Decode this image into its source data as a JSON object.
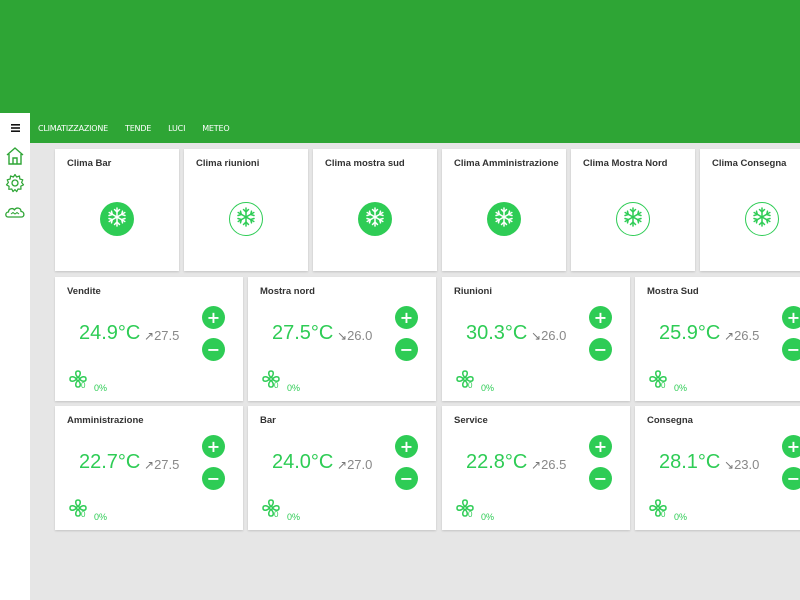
{
  "tabs": [
    "CLIMATIZZAZIONE",
    "TENDE",
    "LUCI",
    "METEO"
  ],
  "sidebar": {
    "menu_icon": "hamburger-icon",
    "items": [
      "home-icon",
      "gear-icon",
      "cloud-icon"
    ]
  },
  "colors": {
    "header": "#2ea535",
    "accent": "#2ecc55",
    "background": "#e6e6e6"
  },
  "clima_units": [
    {
      "name": "Clima Bar",
      "on": true
    },
    {
      "name": "Clima riunioni",
      "on": false
    },
    {
      "name": "Clima mostra sud",
      "on": true
    },
    {
      "name": "Clima Amministrazione",
      "on": true
    },
    {
      "name": "Clima Mostra Nord",
      "on": false
    },
    {
      "name": "Clima Consegna",
      "on": false
    }
  ],
  "zones": [
    {
      "name": "Vendite",
      "temp": "24.9°C",
      "arrow": "↗",
      "setpoint": "27.5",
      "fan_level": "0",
      "fan_pct": "0%"
    },
    {
      "name": "Mostra nord",
      "temp": "27.5°C",
      "arrow": "↘",
      "setpoint": "26.0",
      "fan_level": "0",
      "fan_pct": "0%"
    },
    {
      "name": "Riunioni",
      "temp": "30.3°C",
      "arrow": "↘",
      "setpoint": "26.0",
      "fan_level": "0",
      "fan_pct": "0%"
    },
    {
      "name": "Mostra Sud",
      "temp": "25.9°C",
      "arrow": "↗",
      "setpoint": "26.5",
      "fan_level": "0",
      "fan_pct": "0%"
    },
    {
      "name": "Amministrazione",
      "temp": "22.7°C",
      "arrow": "↗",
      "setpoint": "27.5",
      "fan_level": "0",
      "fan_pct": "0%"
    },
    {
      "name": "Bar",
      "temp": "24.0°C",
      "arrow": "↗",
      "setpoint": "27.0",
      "fan_level": "0",
      "fan_pct": "0%"
    },
    {
      "name": "Service",
      "temp": "22.8°C",
      "arrow": "↗",
      "setpoint": "26.5",
      "fan_level": "0",
      "fan_pct": "0%"
    },
    {
      "name": "Consegna",
      "temp": "28.1°C",
      "arrow": "↘",
      "setpoint": "23.0",
      "fan_level": "0",
      "fan_pct": "0%"
    }
  ],
  "controls": {
    "plus": "+",
    "minus": "−"
  }
}
